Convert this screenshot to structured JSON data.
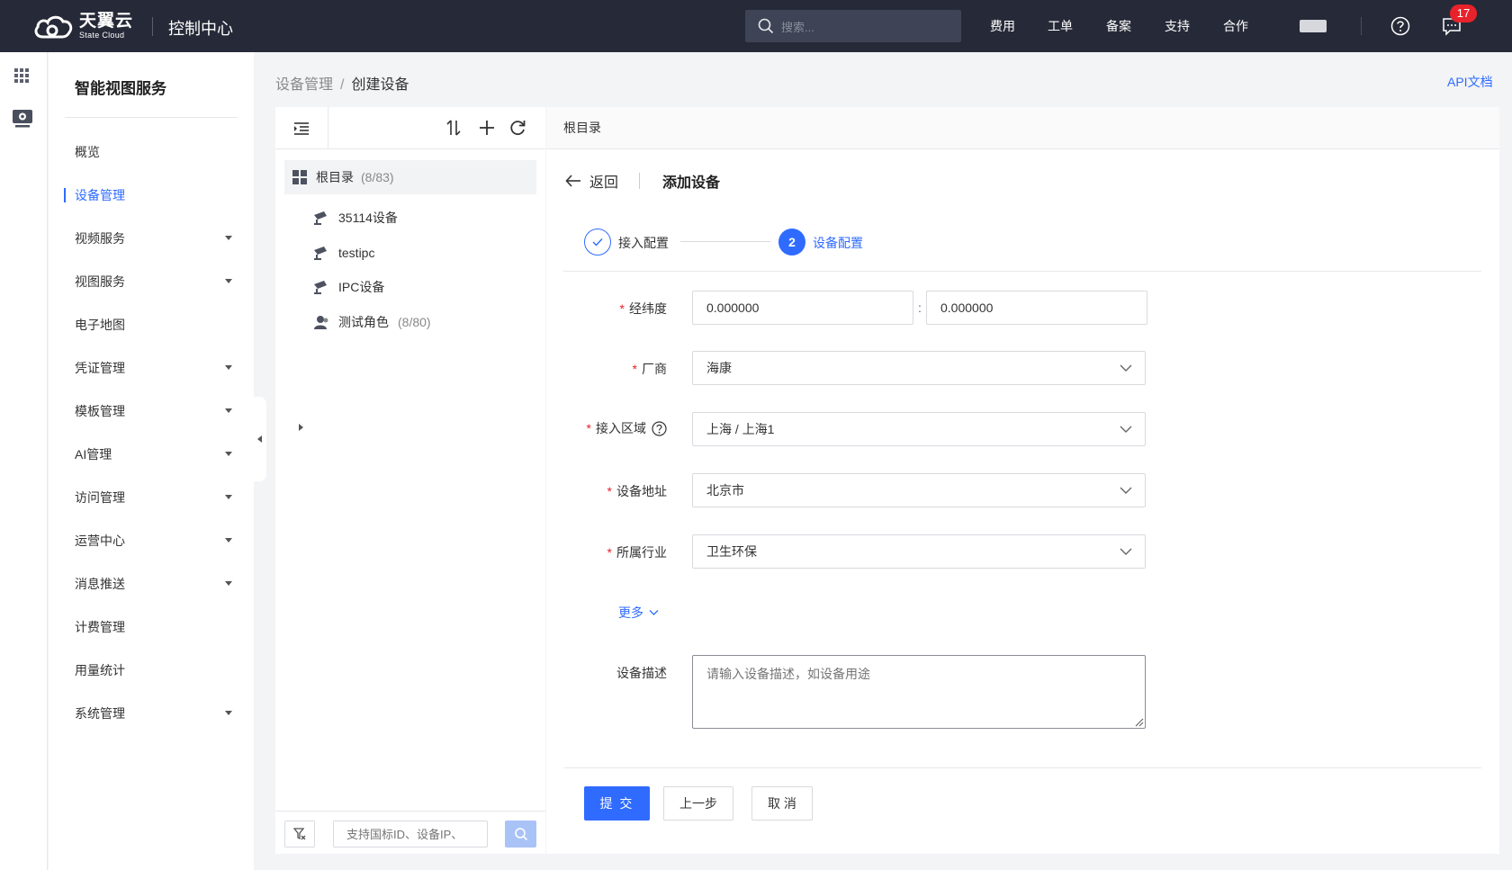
{
  "header": {
    "logo_cn": "天翼云",
    "logo_en": "State Cloud",
    "console": "控制中心",
    "search_placeholder": "搜索...",
    "nav": [
      "费用",
      "工单",
      "备案",
      "支持",
      "合作"
    ],
    "message_count": "17"
  },
  "sidebar": {
    "title": "智能视图服务",
    "items": [
      {
        "label": "概览"
      },
      {
        "label": "设备管理",
        "active": true
      },
      {
        "label": "视频服务",
        "expandable": true
      },
      {
        "label": "视图服务",
        "expandable": true
      },
      {
        "label": "电子地图"
      },
      {
        "label": "凭证管理",
        "expandable": true
      },
      {
        "label": "模板管理",
        "expandable": true
      },
      {
        "label": "AI管理",
        "expandable": true
      },
      {
        "label": "访问管理",
        "expandable": true
      },
      {
        "label": "运营中心",
        "expandable": true
      },
      {
        "label": "消息推送",
        "expandable": true
      },
      {
        "label": "计费管理"
      },
      {
        "label": "用量统计"
      },
      {
        "label": "系统管理",
        "expandable": true
      }
    ]
  },
  "breadcrumb": {
    "parent": "设备管理",
    "separator": "/",
    "current": "创建设备"
  },
  "api_doc": "API文档",
  "tree": {
    "root_label": "根目录",
    "root_count": "(8/83)",
    "nodes": [
      {
        "label": "35114设备",
        "icon": "camera-icon"
      },
      {
        "label": "testipc",
        "icon": "camera-icon"
      },
      {
        "label": "IPC设备",
        "icon": "camera-icon"
      },
      {
        "label": "测试角色",
        "count": "(8/80)",
        "icon": "user-group-icon"
      }
    ],
    "search_placeholder": "支持国标ID、设备IP、"
  },
  "panel": {
    "header": "根目录",
    "back": "返回",
    "title": "添加设备",
    "steps": [
      {
        "label": "接入配置",
        "status": "done"
      },
      {
        "number": "2",
        "label": "设备配置",
        "status": "active"
      }
    ]
  },
  "form": {
    "lnglat_label": "经纬度",
    "lng_value": "0.000000",
    "lat_value": "0.000000",
    "lnglat_sep": ":",
    "vendor_label": "厂商",
    "vendor_value": "海康",
    "region_label": "接入区域",
    "region_value": "上海 / 上海1",
    "address_label": "设备地址",
    "address_value": "北京市",
    "industry_label": "所属行业",
    "industry_value": "卫生环保",
    "more": "更多",
    "desc_label": "设备描述",
    "desc_placeholder": "请输入设备描述，如设备用途"
  },
  "buttons": {
    "submit": "提 交",
    "prev": "上一步",
    "cancel": "取 消"
  },
  "colors": {
    "header_bg": "#262a38",
    "accent": "#2f6bff",
    "badge": "#e8222a"
  }
}
